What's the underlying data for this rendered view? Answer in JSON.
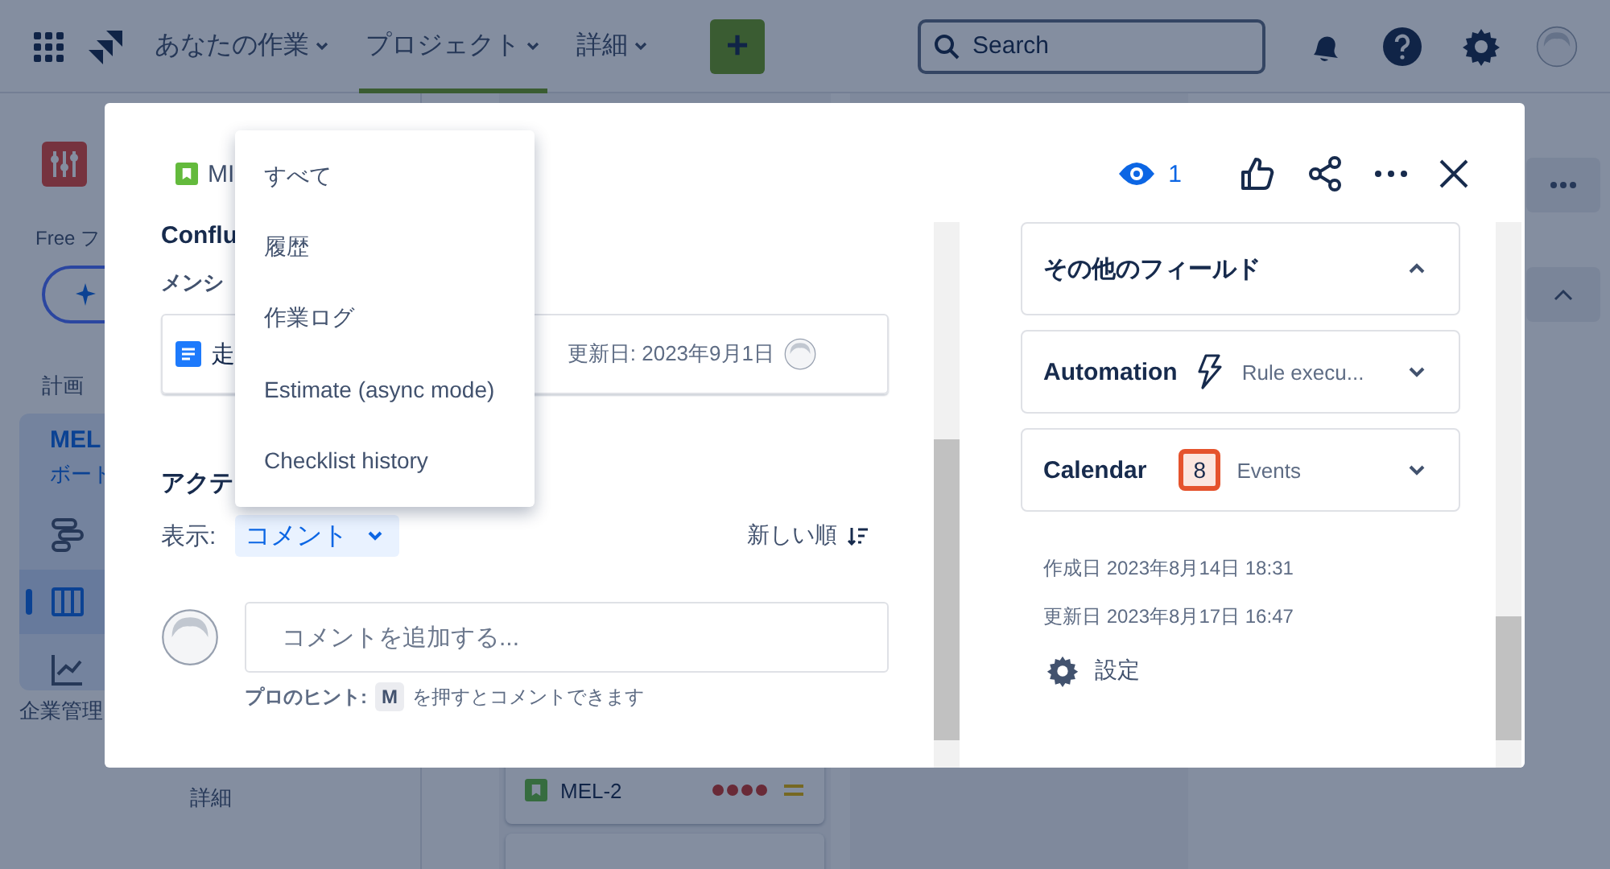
{
  "top_nav": {
    "items": [
      {
        "label": "あなたの作業",
        "selected": false
      },
      {
        "label": "プロジェクト",
        "selected": true
      },
      {
        "label": "詳細",
        "selected": false
      }
    ],
    "create_button": "+",
    "search": {
      "placeholder": "Search"
    }
  },
  "sidebar": {
    "plan_label": "Free フ",
    "section": "計画",
    "project": {
      "name": "MEL",
      "subtitle": "ボート",
      "selected": true
    },
    "nav_icons": [
      {
        "kind": "timeline",
        "selected": false
      },
      {
        "kind": "board",
        "selected": true
      },
      {
        "kind": "reports",
        "selected": false
      }
    ],
    "footer": "企業管理",
    "more": "詳細"
  },
  "board": {
    "cards": [
      {
        "key": "MEL-2"
      }
    ]
  },
  "modal": {
    "issue_key": "MI",
    "watchers": "1",
    "left": {
      "section_title": "Conflu",
      "mention_label": "メンシ",
      "page": {
        "title": "走",
        "updated": "更新日: 2023年9月1日"
      },
      "activity_title": "アクテ",
      "show_label": "表示:",
      "filter": "コメント",
      "sort": "新しい順",
      "comment": {
        "placeholder": "コメントを追加する..."
      },
      "hint": {
        "label": "プロのヒント:",
        "key": "M",
        "text": "を押すとコメントできます"
      }
    },
    "right": {
      "fields_title": "その他のフィールド",
      "fields_expanded": true,
      "apps": [
        {
          "kind": "automation",
          "name": "Automation",
          "value": "Rule execu..."
        },
        {
          "kind": "calendar",
          "name": "Calendar",
          "badge": "8",
          "value": "Events"
        }
      ],
      "created": "作成日 2023年8月14日 18:31",
      "updated": "更新日 2023年8月17日 16:47",
      "settings": "設定"
    }
  },
  "dropdown": {
    "items": [
      {
        "label": "すべて"
      },
      {
        "label": "履歴"
      },
      {
        "label": "作業ログ"
      },
      {
        "label": "Estimate (async mode)"
      },
      {
        "label": "Checklist history"
      }
    ]
  }
}
